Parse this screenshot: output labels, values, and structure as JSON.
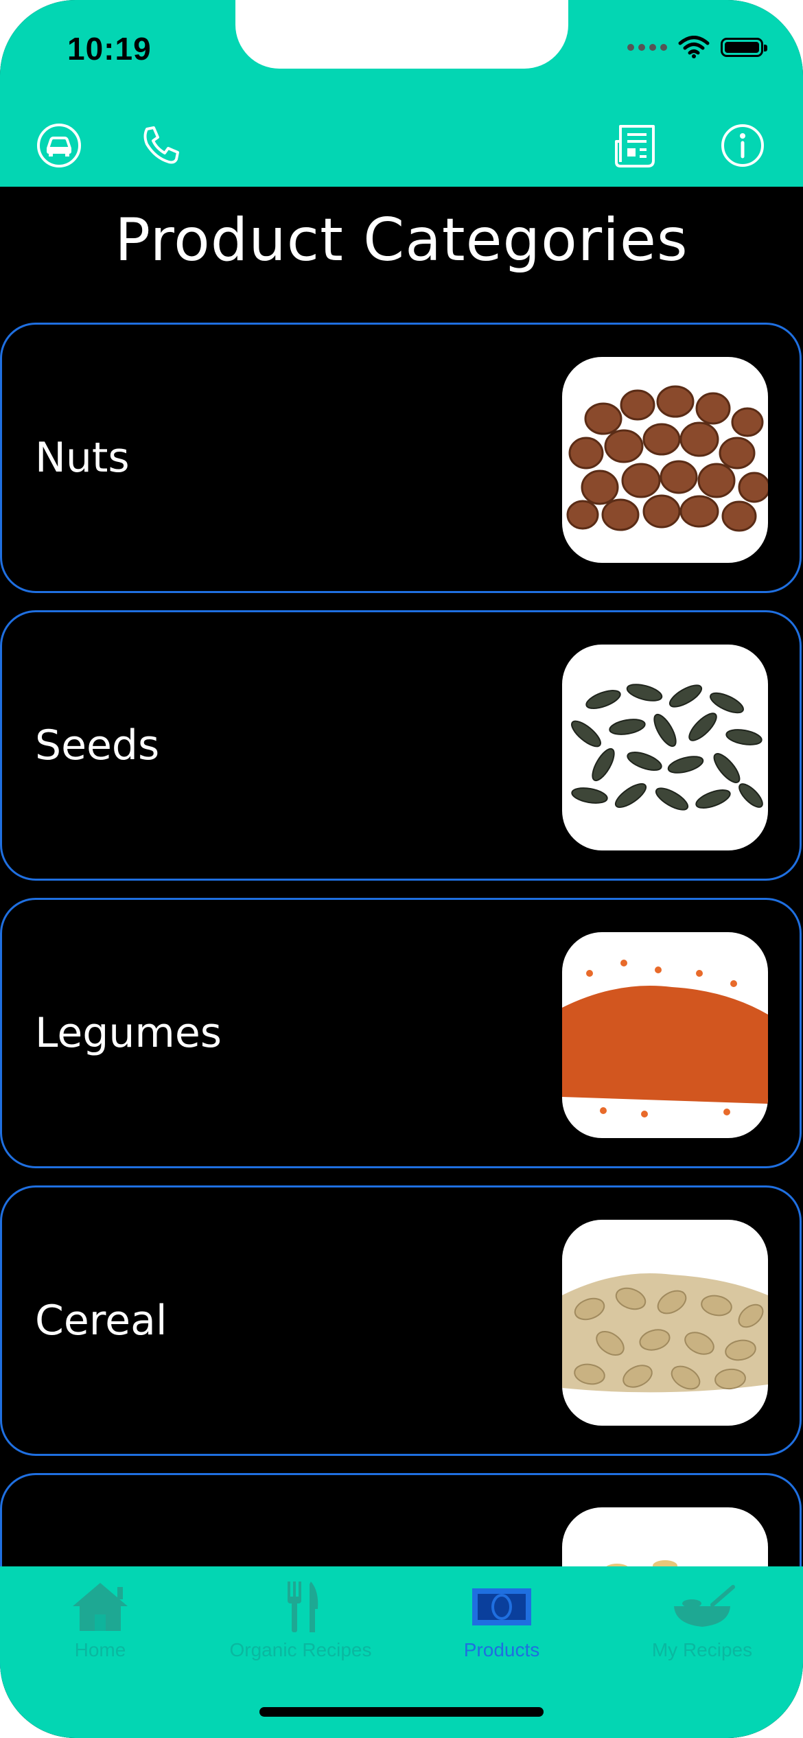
{
  "status_bar": {
    "time": "10:19"
  },
  "top_nav": {
    "icons": [
      "car-icon",
      "phone-icon",
      "news-icon",
      "info-icon"
    ]
  },
  "page": {
    "title": "Product Categories"
  },
  "categories": [
    {
      "label": "Nuts",
      "image": "hazelnuts-image"
    },
    {
      "label": "Seeds",
      "image": "pumpkin-seeds-image"
    },
    {
      "label": "Legumes",
      "image": "red-lentils-image"
    },
    {
      "label": "Cereal",
      "image": "oat-flakes-image"
    },
    {
      "label": "",
      "image": "pasta-image"
    }
  ],
  "tab_bar": {
    "tabs": [
      {
        "label": "Home",
        "icon": "house-icon",
        "active": false
      },
      {
        "label": "Organic Recipes",
        "icon": "fork-knife-icon",
        "active": false
      },
      {
        "label": "Products",
        "icon": "products-icon",
        "active": true
      },
      {
        "label": "My Recipes",
        "icon": "bowl-icon",
        "active": false
      }
    ]
  },
  "colors": {
    "accent": "#03d6b3",
    "card_border": "#1f6fe0",
    "background": "#000000",
    "active_tab": "#1f6fe0"
  }
}
